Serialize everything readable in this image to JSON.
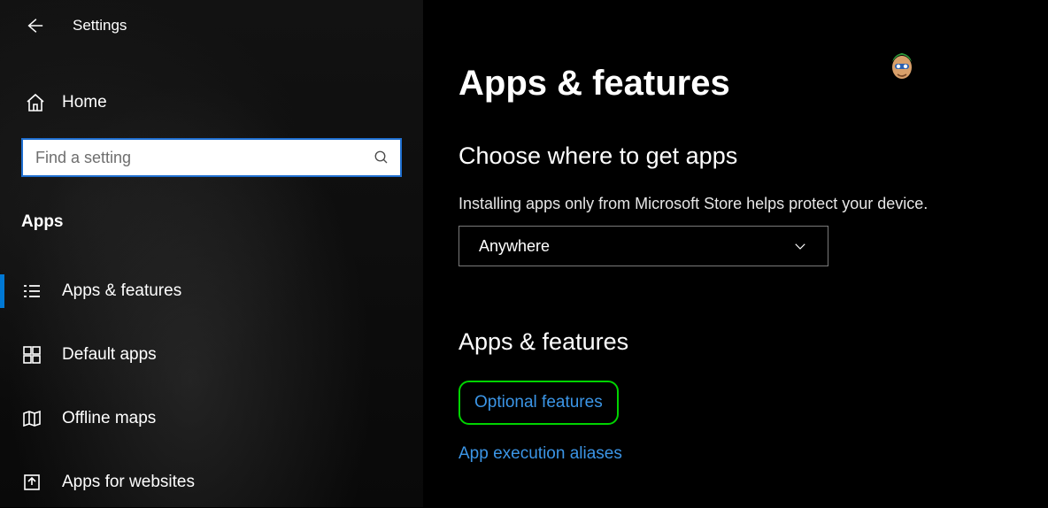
{
  "app": {
    "title": "Settings"
  },
  "sidebar": {
    "home_label": "Home",
    "search_placeholder": "Find a setting",
    "category_label": "Apps",
    "items": [
      {
        "label": "Apps & features",
        "icon": "list-icon",
        "selected": true
      },
      {
        "label": "Default apps",
        "icon": "defaults-icon",
        "selected": false
      },
      {
        "label": "Offline maps",
        "icon": "map-icon",
        "selected": false
      },
      {
        "label": "Apps for websites",
        "icon": "share-icon",
        "selected": false
      }
    ]
  },
  "main": {
    "page_title": "Apps & features",
    "section1_heading": "Choose where to get apps",
    "section1_helper": "Installing apps only from Microsoft Store helps protect your device.",
    "source_dropdown_value": "Anywhere",
    "section2_heading": "Apps & features",
    "links": {
      "optional_features": "Optional features",
      "app_execution_aliases": "App execution aliases"
    }
  }
}
